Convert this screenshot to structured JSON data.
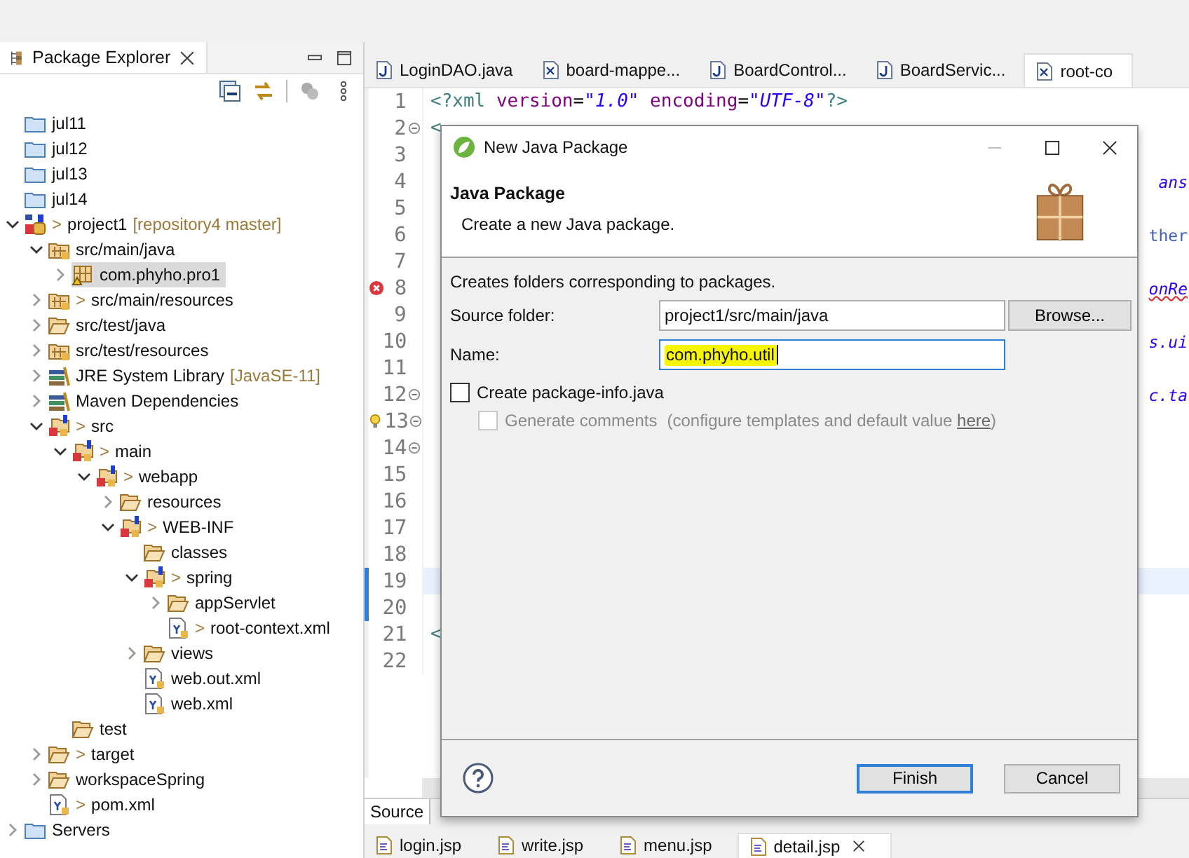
{
  "explorer": {
    "title": "Package Explorer",
    "tree": [
      {
        "label": "jul11",
        "kind": "folder",
        "selected": false
      },
      {
        "label": "jul12",
        "kind": "folder",
        "selected": false
      },
      {
        "label": "jul13",
        "kind": "folder",
        "selected": false
      },
      {
        "label": "jul14",
        "kind": "folder",
        "selected": false
      },
      {
        "label": "project1",
        "prefix": ">",
        "suffix": "[repository4 master]",
        "kind": "project",
        "selected": false,
        "expanded": true,
        "children": [
          {
            "label": "src/main/java",
            "kind": "source-folder",
            "selected": false,
            "expanded": true,
            "children": [
              {
                "label": "com.phyho.pro1",
                "kind": "package",
                "selected": true,
                "expanded": false
              }
            ]
          },
          {
            "label": "src/main/resources",
            "prefix": ">",
            "kind": "source-folder",
            "selected": false,
            "expanded": false
          },
          {
            "label": "src/test/java",
            "kind": "open-folder",
            "selected": false,
            "expanded": false
          },
          {
            "label": "src/test/resources",
            "kind": "source-folder",
            "selected": false,
            "expanded": false
          },
          {
            "label": "JRE System Library",
            "suffix": "[JavaSE-11]",
            "kind": "library",
            "selected": false,
            "expanded": false
          },
          {
            "label": "Maven Dependencies",
            "kind": "library",
            "selected": false,
            "expanded": false
          },
          {
            "label": "src",
            "prefix": ">",
            "kind": "web-folder",
            "selected": false,
            "expanded": true,
            "children": [
              {
                "label": "main",
                "prefix": ">",
                "kind": "web-folder",
                "selected": false,
                "expanded": true,
                "children": [
                  {
                    "label": "webapp",
                    "prefix": ">",
                    "kind": "web-folder",
                    "selected": false,
                    "expanded": true,
                    "children": [
                      {
                        "label": "resources",
                        "kind": "open-folder",
                        "selected": false,
                        "expanded": false
                      },
                      {
                        "label": "WEB-INF",
                        "prefix": ">",
                        "kind": "web-folder",
                        "selected": false,
                        "expanded": true,
                        "children": [
                          {
                            "label": "classes",
                            "kind": "open-folder",
                            "selected": false
                          },
                          {
                            "label": "spring",
                            "prefix": ">",
                            "kind": "web-folder",
                            "selected": false,
                            "expanded": true,
                            "children": [
                              {
                                "label": "appServlet",
                                "kind": "open-folder",
                                "selected": false,
                                "expanded": false
                              },
                              {
                                "label": "root-context.xml",
                                "prefix": ">",
                                "kind": "xml-file",
                                "selected": false
                              }
                            ]
                          },
                          {
                            "label": "views",
                            "kind": "open-folder",
                            "selected": false,
                            "expanded": false
                          },
                          {
                            "label": "web.out.xml",
                            "kind": "xml-file",
                            "selected": false
                          },
                          {
                            "label": "web.xml",
                            "kind": "xml-file",
                            "selected": false
                          }
                        ]
                      }
                    ]
                  }
                ]
              },
              {
                "label": "test",
                "kind": "open-folder",
                "selected": false
              }
            ]
          },
          {
            "label": "target",
            "prefix": ">",
            "kind": "open-folder",
            "selected": false,
            "expanded": false
          },
          {
            "label": "workspaceSpring",
            "kind": "open-folder",
            "selected": false,
            "expanded": false
          },
          {
            "label": "pom.xml",
            "prefix": ">",
            "kind": "xml-file",
            "selected": false
          }
        ]
      },
      {
        "label": "Servers",
        "kind": "folder",
        "selected": false,
        "expanded": false
      }
    ]
  },
  "editor": {
    "tabs": [
      {
        "label": "LoginDAO.java",
        "kind": "java",
        "selected": false
      },
      {
        "label": "board-mappe...",
        "kind": "xml",
        "selected": false
      },
      {
        "label": "BoardControl...",
        "kind": "java",
        "selected": false
      },
      {
        "label": "BoardServic...",
        "kind": "java",
        "selected": false
      },
      {
        "label": "root-co",
        "kind": "xml",
        "selected": true
      }
    ],
    "lines": [
      {
        "number": "1",
        "kind": "plain",
        "tokens": [
          {
            "text": "<?",
            "kind": "tag"
          },
          {
            "text": "xml ",
            "kind": "tag"
          },
          {
            "text": "version",
            "kind": "attr"
          },
          {
            "text": "=",
            "kind": "plain"
          },
          {
            "text": "\"1.0\"",
            "kind": "value"
          },
          {
            "text": " encoding",
            "kind": "attr"
          },
          {
            "text": "=",
            "kind": "plain"
          },
          {
            "text": "\"UTF-8\"",
            "kind": "value"
          },
          {
            "text": "?>",
            "kind": "tag"
          }
        ]
      },
      {
        "number": "2",
        "kind": "plain",
        "fold": true,
        "tokens": [
          {
            "text": "<",
            "kind": "tag"
          }
        ]
      },
      {
        "number": "3",
        "kind": "plain"
      },
      {
        "number": "4",
        "kind": "plain",
        "tail": {
          "text": "ans",
          "kind": "value"
        }
      },
      {
        "number": "5",
        "kind": "plain"
      },
      {
        "number": "6",
        "kind": "plain",
        "tail": {
          "text": "ther",
          "kind": "plain-blue"
        }
      },
      {
        "number": "7",
        "kind": "plain"
      },
      {
        "number": "8",
        "kind": "error",
        "tail": {
          "text": "onRe",
          "kind": "error-value"
        }
      },
      {
        "number": "9",
        "kind": "plain"
      },
      {
        "number": "10",
        "kind": "plain",
        "tail": {
          "text": "s.ui",
          "kind": "value"
        }
      },
      {
        "number": "11",
        "kind": "plain"
      },
      {
        "number": "12",
        "kind": "plain",
        "fold": true,
        "tail": {
          "text": "c.ta",
          "kind": "value"
        }
      },
      {
        "number": "13",
        "kind": "bulb",
        "fold": true
      },
      {
        "number": "14",
        "kind": "plain",
        "fold": true
      },
      {
        "number": "15",
        "kind": "plain"
      },
      {
        "number": "16",
        "kind": "plain"
      },
      {
        "number": "17",
        "kind": "plain"
      },
      {
        "number": "18",
        "kind": "plain"
      },
      {
        "number": "19",
        "kind": "plain",
        "current": true,
        "changed": true
      },
      {
        "number": "20",
        "kind": "plain",
        "changed": true
      },
      {
        "number": "21",
        "kind": "plain",
        "tokens": [
          {
            "text": "<",
            "kind": "tag"
          }
        ]
      },
      {
        "number": "22",
        "kind": "plain"
      }
    ],
    "bottom_tabs": [
      {
        "label": "Source",
        "selected": true
      }
    ]
  },
  "views": {
    "tabs": [
      {
        "label": "login.jsp",
        "selected": false
      },
      {
        "label": "write.jsp",
        "selected": false
      },
      {
        "label": "menu.jsp",
        "selected": false
      },
      {
        "label": "detail.jsp",
        "selected": true
      }
    ]
  },
  "dialog": {
    "title": "New Java Package",
    "heading": "Java Package",
    "description": "Create a new Java package.",
    "message": "Creates folders corresponding to packages.",
    "fields": [
      {
        "label": "Source folder:",
        "value": "project1/src/main/java",
        "focused": false,
        "highlighted": false,
        "button": "Browse..."
      },
      {
        "label": "Name:",
        "value": "com.phyho.util",
        "focused": true,
        "highlighted": true
      }
    ],
    "options": [
      {
        "label": "Create package-info.java",
        "checked": false,
        "disabled": false
      },
      {
        "label": "Generate comments",
        "note": "(configure templates and default value ",
        "link": "here",
        "note_end": ")",
        "checked": false,
        "disabled": true
      }
    ],
    "buttons": [
      {
        "label": "Finish",
        "default": true
      },
      {
        "label": "Cancel",
        "default": false
      }
    ]
  }
}
